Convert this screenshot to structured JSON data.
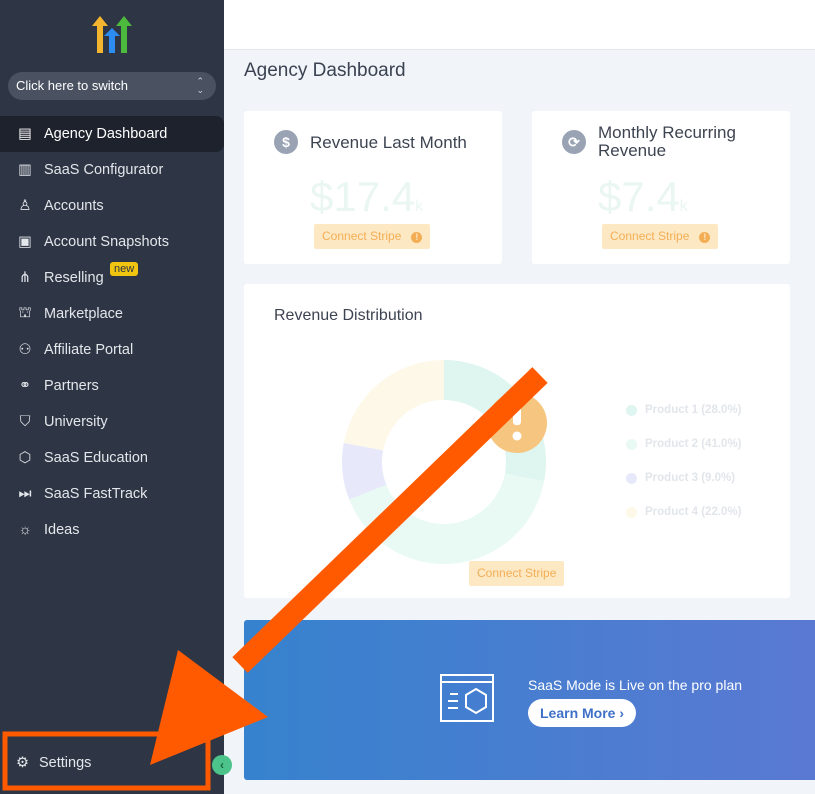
{
  "sidebar": {
    "switcher_label": "Click here to switch",
    "items": [
      {
        "label": "Agency Dashboard",
        "icon": "dashboard-icon",
        "active": true
      },
      {
        "label": "SaaS Configurator",
        "icon": "bar-chart-icon"
      },
      {
        "label": "Accounts",
        "icon": "user-icon"
      },
      {
        "label": "Account Snapshots",
        "icon": "snapshot-icon"
      },
      {
        "label": "Reselling",
        "icon": "reselling-icon",
        "badge": "new"
      },
      {
        "label": "Marketplace",
        "icon": "bag-icon"
      },
      {
        "label": "Affiliate Portal",
        "icon": "users-icon"
      },
      {
        "label": "Partners",
        "icon": "handshake-icon"
      },
      {
        "label": "University",
        "icon": "graduation-cap-icon"
      },
      {
        "label": "SaaS Education",
        "icon": "box-icon"
      },
      {
        "label": "SaaS FastTrack",
        "icon": "fast-forward-icon"
      },
      {
        "label": "Ideas",
        "icon": "lightbulb-icon"
      }
    ],
    "settings_label": "Settings"
  },
  "main": {
    "title": "Agency Dashboard",
    "cards": [
      {
        "title": "Revenue Last Month",
        "value": "$17.4",
        "unit": "k",
        "button": "Connect Stripe"
      },
      {
        "title": "Monthly Recurring Revenue",
        "value": "$7.4",
        "unit": "k",
        "button": "Connect Stripe"
      }
    ],
    "distribution": {
      "title": "Revenue Distribution",
      "button": "Connect Stripe",
      "legend": [
        {
          "label": "Product 1 (28.0%)",
          "value": 28,
          "color": "#dff5ef"
        },
        {
          "label": "Product 2 (41.0%)",
          "value": 41,
          "color": "#e9f9f3"
        },
        {
          "label": "Product 3 (9.0%)",
          "value": 9,
          "color": "#e7e9fb"
        },
        {
          "label": "Product 4 (22.0%)",
          "value": 22,
          "color": "#fdf8e7"
        }
      ]
    },
    "banner": {
      "text": "SaaS Mode is Live on the pro plan",
      "button": "Learn More"
    }
  },
  "colors": {
    "sidebar": "#2e3544",
    "accent_orange": "#ff5a00",
    "stripe": "#f3ae55"
  }
}
